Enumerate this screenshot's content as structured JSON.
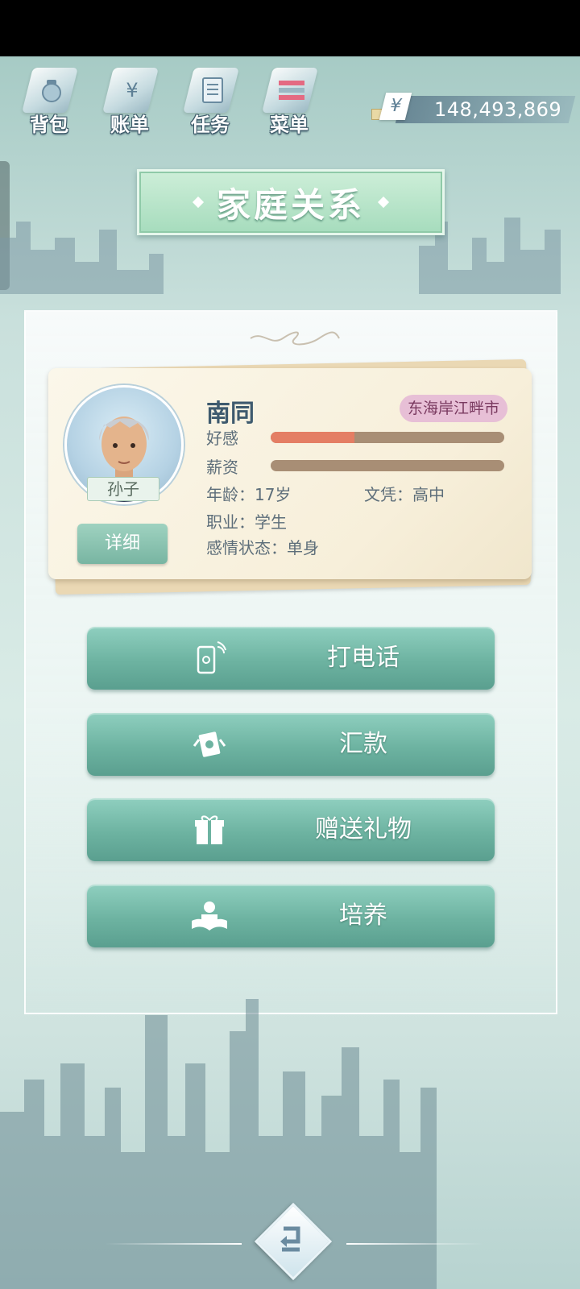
{
  "top_nav": {
    "items": [
      {
        "label": "背包",
        "icon": "bag-icon"
      },
      {
        "label": "账单",
        "icon": "yen-bill-icon"
      },
      {
        "label": "任务",
        "icon": "task-list-icon"
      },
      {
        "label": "菜单",
        "icon": "menu-icon"
      }
    ]
  },
  "money": {
    "currency_symbol": "¥",
    "amount": "148,493,869"
  },
  "title": "家庭关系",
  "member": {
    "name": "南同",
    "city": "东海岸江畔市",
    "relation": "孙子",
    "detail_label": "详细",
    "stats": [
      {
        "label": "好感",
        "fraction": 0.36
      },
      {
        "label": "薪资",
        "fraction": 0.0
      }
    ],
    "age": "年龄：17岁",
    "education": "文凭：高中",
    "occupation": "职业：学生",
    "relationship": "感情状态：单身"
  },
  "actions": [
    {
      "label": "打电话",
      "icon": "phone-icon"
    },
    {
      "label": "汇款",
      "icon": "money-transfer-icon"
    },
    {
      "label": "赠送礼物",
      "icon": "gift-icon"
    },
    {
      "label": "培养",
      "icon": "study-book-icon"
    }
  ],
  "colors": {
    "accent": "#78b5a2",
    "favor_bar": "#e47e64",
    "bar_track": "#a88e75",
    "city_tag": "#e7bfd6"
  }
}
